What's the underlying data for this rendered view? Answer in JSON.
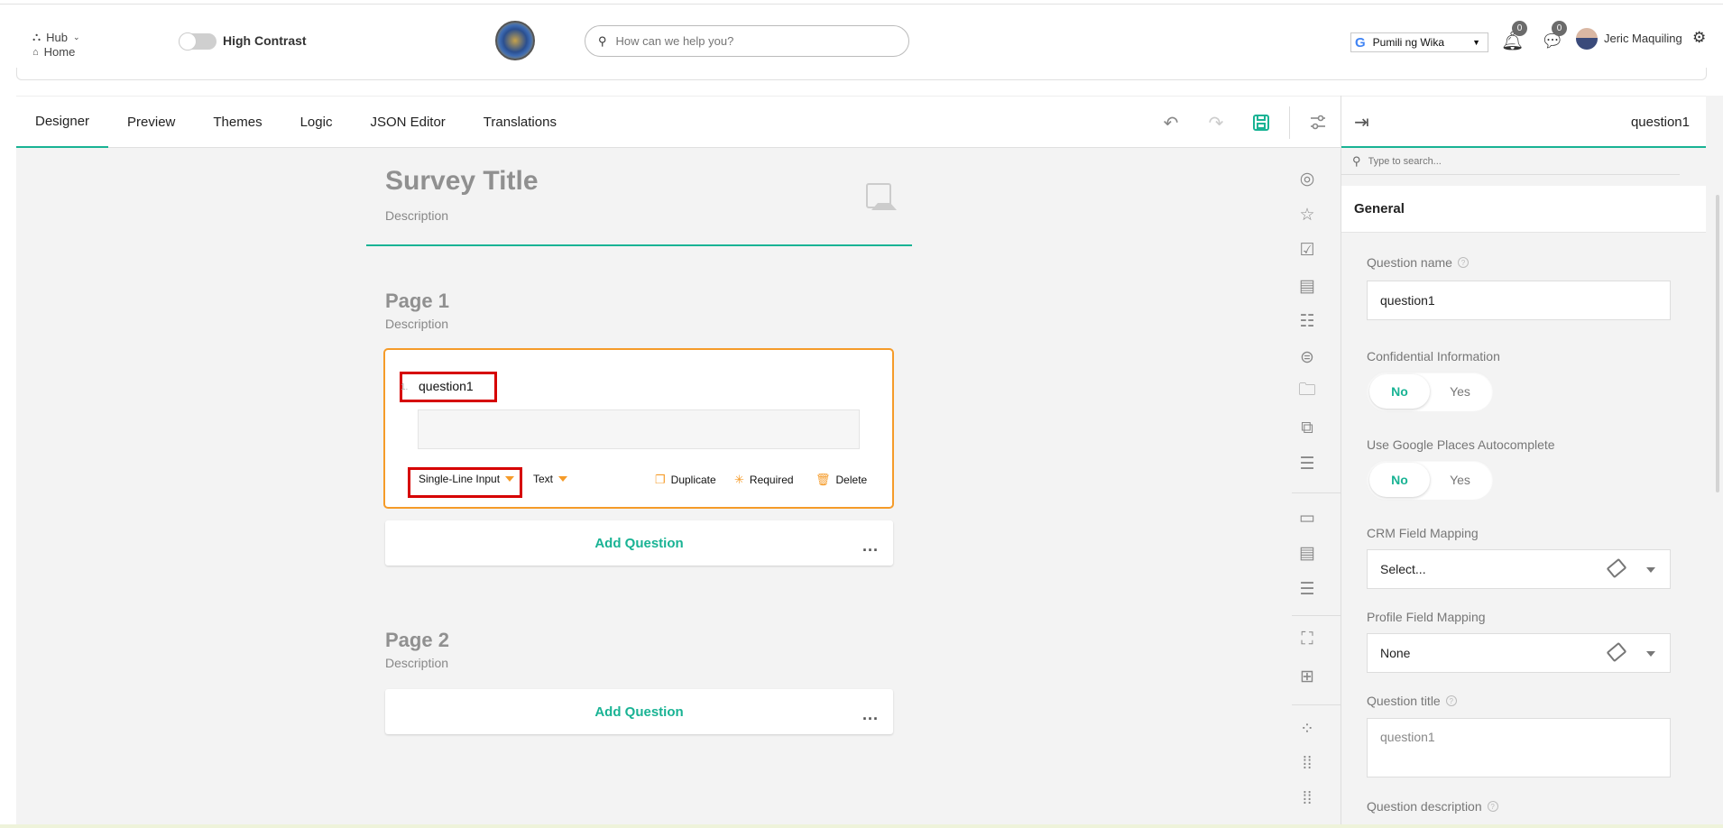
{
  "header": {
    "hub_label": "Hub",
    "home_label": "Home",
    "high_contrast_label": "High Contrast",
    "search_placeholder": "How can we help you?",
    "language_label": "Pumili ng Wika",
    "notifications_count": "0",
    "messages_count": "0",
    "user_name": "Jeric Maquiling"
  },
  "designer": {
    "tabs": [
      {
        "label": "Designer",
        "active": true
      },
      {
        "label": "Preview"
      },
      {
        "label": "Themes"
      },
      {
        "label": "Logic"
      },
      {
        "label": "JSON Editor"
      },
      {
        "label": "Translations"
      }
    ]
  },
  "survey": {
    "title": "Survey Title",
    "description": "Description",
    "pages": [
      {
        "title": "Page 1",
        "description": "Description"
      },
      {
        "title": "Page 2",
        "description": "Description"
      }
    ],
    "question": {
      "number": "1.",
      "title": "question1",
      "type_label": "Single-Line Input",
      "input_type_label": "Text",
      "duplicate_label": "Duplicate",
      "required_label": "Required",
      "delete_label": "Delete"
    },
    "add_question_label": "Add Question",
    "more_label": "..."
  },
  "panel": {
    "selected_name": "question1",
    "search_placeholder": "Type to search...",
    "section_label": "General",
    "question_name_label": "Question name",
    "question_name_value": "question1",
    "confidential_label": "Confidential Information",
    "no_label": "No",
    "yes_label": "Yes",
    "google_places_label": "Use Google Places Autocomplete",
    "crm_label": "CRM Field Mapping",
    "crm_value": "Select...",
    "profile_label": "Profile Field Mapping",
    "profile_value": "None",
    "question_title_label": "Question title",
    "question_title_value": "question1",
    "question_description_label": "Question description"
  },
  "colors": {
    "accent": "#19b394",
    "highlight": "#f59b29",
    "annotation": "#d60000"
  }
}
